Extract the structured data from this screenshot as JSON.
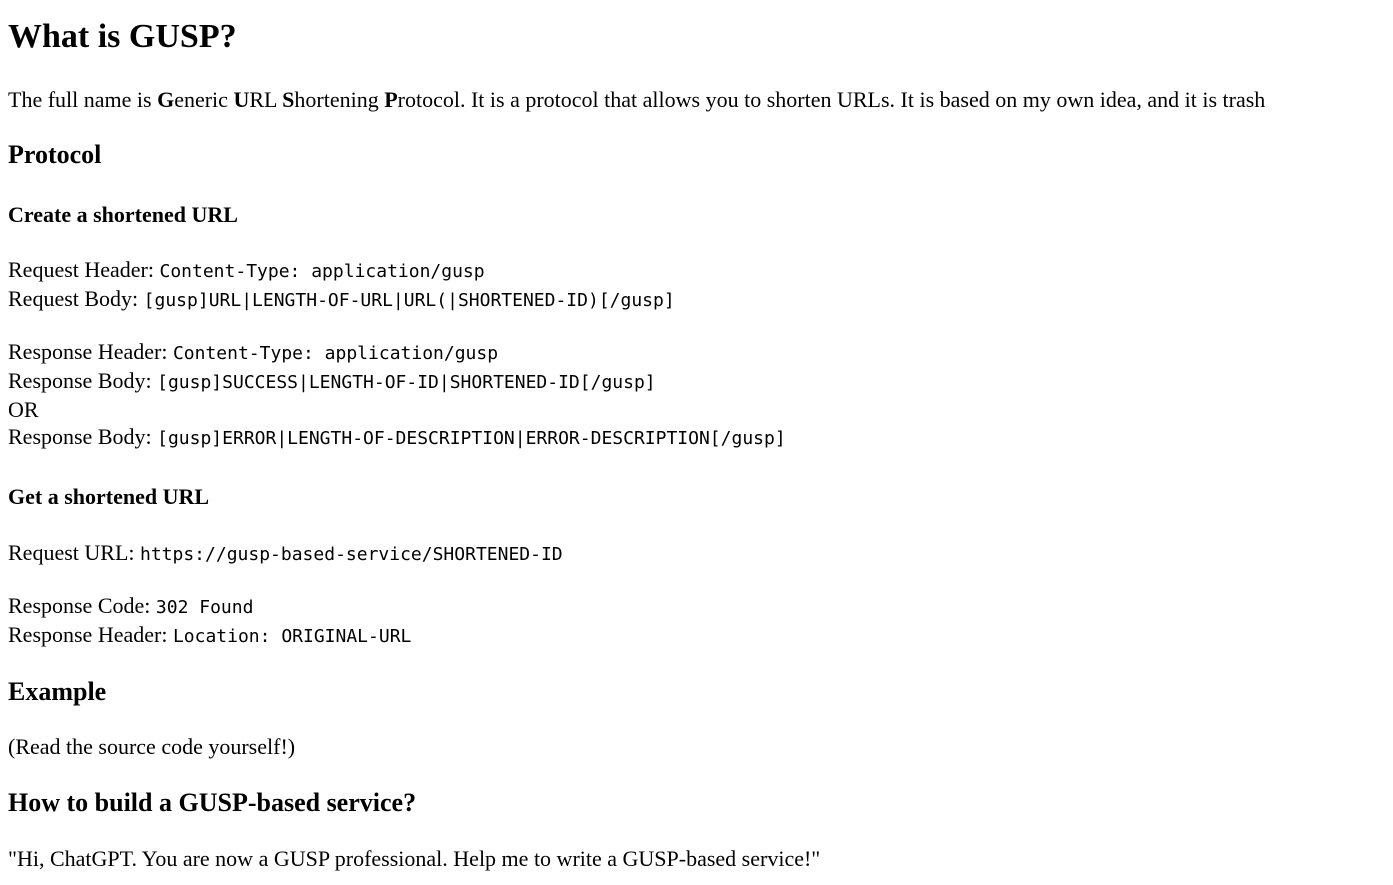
{
  "title": "What is GUSP?",
  "intro": {
    "prefix": "The full name is ",
    "g_bold": "G",
    "g_rest": "eneric ",
    "u_bold": "U",
    "u_rest": "RL ",
    "s_bold": "S",
    "s_rest": "hortening ",
    "p_bold": "P",
    "p_rest": "rotocol. It is a protocol that allows you to shorten URLs. It is based on my own idea, and it is trash"
  },
  "protocol": {
    "heading": "Protocol",
    "create": {
      "heading": "Create a shortened URL",
      "request_header_label": "Request Header: ",
      "request_header_value": "Content-Type: application/gusp",
      "request_body_label": "Request Body: ",
      "request_body_value": "[gusp]URL|LENGTH-OF-URL|URL(|SHORTENED-ID)[/gusp]",
      "response_header_label": "Response Header: ",
      "response_header_value": "Content-Type: application/gusp",
      "response_body_label": "Response Body: ",
      "response_body_success": "[gusp]SUCCESS|LENGTH-OF-ID|SHORTENED-ID[/gusp]",
      "or_text": "OR",
      "response_body_label_2": "Response Body: ",
      "response_body_error": "[gusp]ERROR|LENGTH-OF-DESCRIPTION|ERROR-DESCRIPTION[/gusp]"
    },
    "get": {
      "heading": "Get a shortened URL",
      "request_url_label": "Request URL: ",
      "request_url_value": "https://gusp-based-service/SHORTENED-ID",
      "response_code_label": "Response Code: ",
      "response_code_value": "302 Found",
      "response_header_label": "Response Header: ",
      "response_header_value": "Location: ORIGINAL-URL"
    }
  },
  "example": {
    "heading": "Example",
    "text": "(Read the source code yourself!)"
  },
  "build": {
    "heading": "How to build a GUSP-based service?",
    "text": "\"Hi, ChatGPT. You are now a GUSP professional. Help me to write a GUSP-based service!\""
  }
}
